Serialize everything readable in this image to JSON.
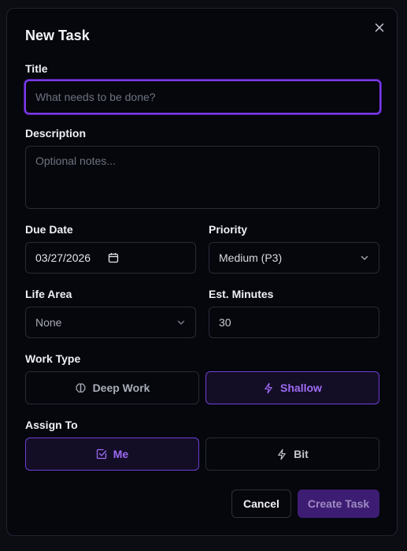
{
  "modal": {
    "title": "New Task",
    "close_label": "close"
  },
  "form": {
    "title": {
      "label": "Title",
      "placeholder": "What needs to be done?",
      "value": ""
    },
    "description": {
      "label": "Description",
      "placeholder": "Optional notes...",
      "value": ""
    },
    "due_date": {
      "label": "Due Date",
      "value": "03/27/2026"
    },
    "priority": {
      "label": "Priority",
      "value": "Medium (P3)"
    },
    "life_area": {
      "label": "Life Area",
      "value": "None"
    },
    "est_minutes": {
      "label": "Est. Minutes",
      "value": "30"
    },
    "work_type": {
      "label": "Work Type",
      "options": [
        {
          "label": "Deep Work",
          "icon": "brain-icon",
          "active": false
        },
        {
          "label": "Shallow",
          "icon": "lightning-icon",
          "active": true
        }
      ]
    },
    "assign_to": {
      "label": "Assign To",
      "options": [
        {
          "label": "Me",
          "icon": "checkbox-icon",
          "active": true
        },
        {
          "label": "Bit",
          "icon": "lightning-icon",
          "active": false
        }
      ]
    }
  },
  "actions": {
    "cancel_label": "Cancel",
    "create_label": "Create Task"
  },
  "colors": {
    "accent": "#7c3aed",
    "accent_text": "#9d6cf3",
    "create_bg": "#3d1d73",
    "modal_bg": "#05070c"
  }
}
